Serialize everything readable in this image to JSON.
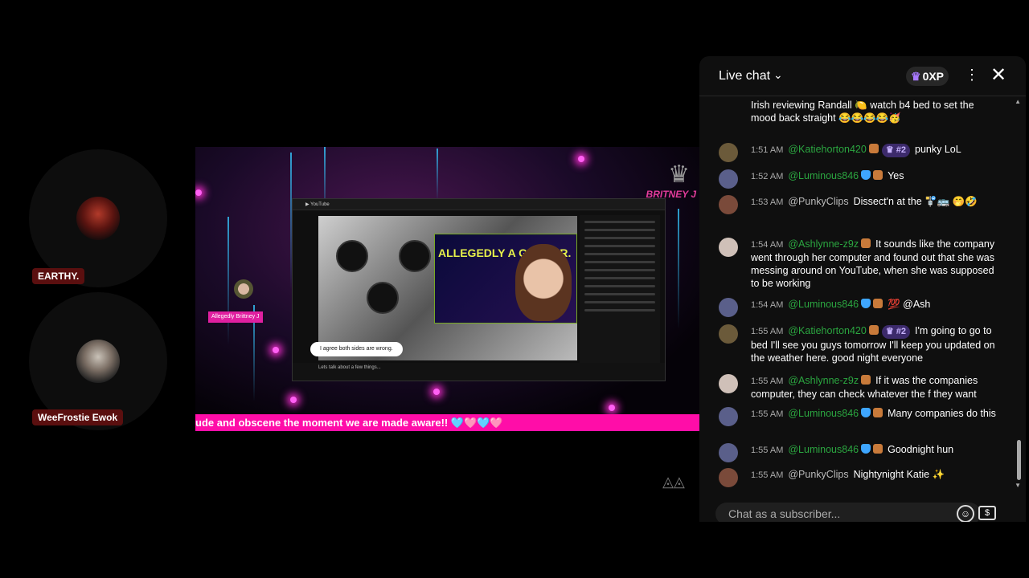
{
  "participants": [
    {
      "name": "EARTHY."
    },
    {
      "name": "WeeFrostie Ewok"
    }
  ],
  "video": {
    "ticker_text": "ude and obscene the moment we are made aware!! 🩵🩷🩵🩷",
    "overlay_brand": "BRITNEY J",
    "inner_title": "ALLEGEDLY A GRIFTER.",
    "inner_bubble": "I agree both sides are wrong.",
    "inner_caption": "Lets talk about a few things...",
    "mini_tag": "Allegedly Brittney J"
  },
  "chat": {
    "title": "Live chat",
    "xp": "0XP",
    "placeholder": "Chat as a subscriber...",
    "messages": [
      {
        "time": "",
        "author": "",
        "rank": "",
        "text": "Irish reviewing Randall 🍋 watch b4 bed to set the mood back straight 😂😂😂😂🥳",
        "color": "#fff"
      },
      {
        "time": "1:51 AM",
        "author": "@Katiehorton420",
        "rank": "#2",
        "text": "punky LoL",
        "color": "#2ba640"
      },
      {
        "time": "1:52 AM",
        "author": "@Luminous846",
        "rank": "",
        "text": "Yes",
        "color": "#2ba640"
      },
      {
        "time": "1:53 AM",
        "author": "@PunkyClips",
        "rank": "",
        "text": "Dissect'n at the 🚏🚌 🤭🤣",
        "color": "#bbb"
      },
      {
        "time": "1:54 AM",
        "author": "@Ashlynne-z9z",
        "rank": "",
        "text": "It sounds like the company went through her computer and found out that she was messing around on YouTube, when she was supposed to be working",
        "color": "#2ba640"
      },
      {
        "time": "1:54 AM",
        "author": "@Luminous846",
        "rank": "",
        "text": "💯 @Ash",
        "color": "#2ba640"
      },
      {
        "time": "1:55 AM",
        "author": "@Katiehorton420",
        "rank": "#2",
        "text": "I'm going to go to bed I'll see you guys tomorrow I'll keep you updated on the weather here. good night everyone",
        "color": "#2ba640"
      },
      {
        "time": "1:55 AM",
        "author": "@Ashlynne-z9z",
        "rank": "",
        "text": "If it was the companies computer, they can check whatever the f they want",
        "color": "#2ba640"
      },
      {
        "time": "1:55 AM",
        "author": "@Luminous846",
        "rank": "",
        "text": "Many companies do this",
        "color": "#2ba640"
      },
      {
        "time": "1:55 AM",
        "author": "@Luminous846",
        "rank": "",
        "text": "Goodnight hun",
        "color": "#2ba640"
      },
      {
        "time": "1:55 AM",
        "author": "@PunkyClips",
        "rank": "",
        "text": "Nightynight Katie ✨",
        "color": "#bbb"
      }
    ]
  }
}
